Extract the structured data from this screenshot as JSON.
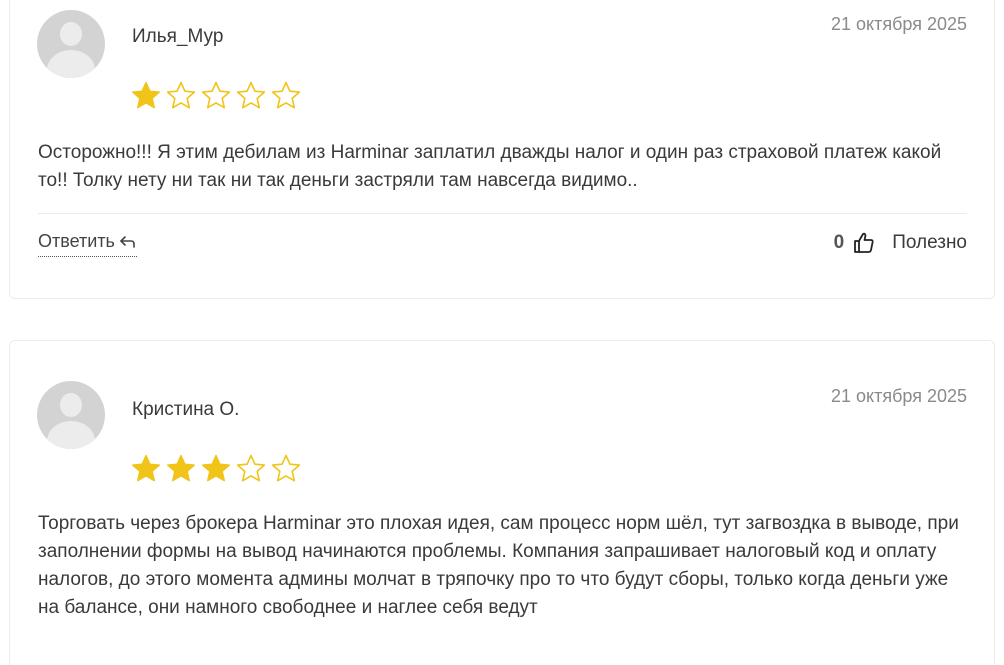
{
  "reviews": [
    {
      "author": "Илья_Мур",
      "date": "21 октября 2025",
      "rating": 1,
      "max_rating": 5,
      "text": "Осторожно!!! Я этим дебилам из Harminar заплатил дважды налог и один раз страховой платеж какой то!! Толку нету ни так ни так деньги застряли там навсегда видимо..",
      "reply_label": "Ответить",
      "helpful_count": "0",
      "helpful_label": "Полезно"
    },
    {
      "author": "Кристина О.",
      "date": "21 октября 2025",
      "rating": 3,
      "max_rating": 5,
      "text": "Торговать через брокера Harminar это плохая идея, сам процесс норм шёл, тут загвоздка в выводе, при заполнении формы на вывод начинаются проблемы. Компания запрашивает налоговый код и оплату налогов, до этого момента админы молчат в тряпочку про то что будут сборы, только когда деньги уже на балансе, они намного свободнее и наглее себя ведут"
    }
  ],
  "colors": {
    "star_filled": "#f0c419",
    "star_empty_stroke": "#f0c419",
    "avatar_bg": "#d3d3d3",
    "card_border": "#ececec"
  },
  "icons": {
    "avatar": "user-placeholder-icon",
    "star_filled": "star-filled-icon",
    "star_empty": "star-outline-icon",
    "reply": "reply-arrow-icon",
    "helpful": "thumbs-up-icon"
  }
}
